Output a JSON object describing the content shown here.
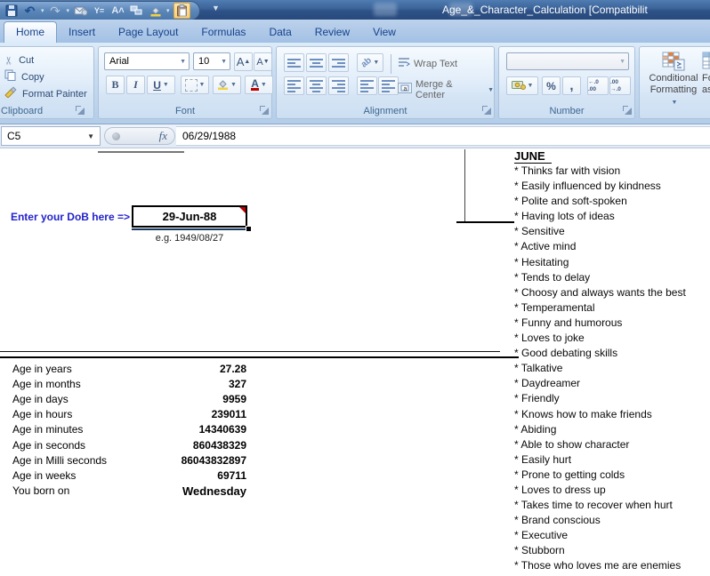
{
  "window": {
    "title": "Age_&_Character_Calculation  [Compatibilit"
  },
  "qat": {
    "icons": [
      "save-icon",
      "undo-icon",
      "redo-icon",
      "mail-attach-icon",
      "filter-icon",
      "font-size-icon",
      "shapes-icon",
      "fill-color-icon",
      "paste-icon",
      "customize-qat-icon"
    ]
  },
  "tabs": [
    {
      "label": "Home",
      "active": true
    },
    {
      "label": "Insert",
      "active": false
    },
    {
      "label": "Page Layout",
      "active": false
    },
    {
      "label": "Formulas",
      "active": false
    },
    {
      "label": "Data",
      "active": false
    },
    {
      "label": "Review",
      "active": false
    },
    {
      "label": "View",
      "active": false
    }
  ],
  "ribbon": {
    "clipboard": {
      "label": "Clipboard",
      "cut": "Cut",
      "copy": "Copy",
      "format_painter": "Format Painter"
    },
    "font": {
      "label": "Font",
      "family": "Arial",
      "size": "10",
      "bold": "B",
      "italic": "I",
      "underline": "U",
      "grow": "A",
      "shrink": "A",
      "color_letter": "A"
    },
    "alignment": {
      "label": "Alignment",
      "wrap_text": "Wrap Text",
      "merge_center": "Merge & Center",
      "orientation": "ab"
    },
    "number": {
      "label": "Number",
      "percent": "%",
      "comma": ",",
      "inc_decimal": "←.0 .00",
      "dec_decimal": ".00 →.0"
    },
    "styles": {
      "conditional_1": "Conditional",
      "conditional_2": "Formatting",
      "format_table_1": "For",
      "format_table_2": "as Ta"
    }
  },
  "formula_bar": {
    "name_box": "C5",
    "fx_label": "fx",
    "value": "06/29/1988"
  },
  "sheet": {
    "dob_label": "Enter your DoB here =>",
    "dob_value": "29-Jun-88",
    "dob_hint": "e.g. 1949/08/27",
    "month_header": "JUNE",
    "traits": [
      "* Thinks far with vision",
      "* Easily influenced by kindness",
      "* Polite and soft-spoken",
      "* Having lots of ideas",
      "* Sensitive",
      "* Active mind",
      "* Hesitating",
      "* Tends to delay",
      "* Choosy and always wants the best",
      "* Temperamental",
      "* Funny and humorous",
      "* Loves to joke",
      "* Good debating skills",
      "* Talkative",
      "* Daydreamer",
      "* Friendly",
      "* Knows how to make friends",
      "* Abiding",
      "* Able to show character",
      "* Easily hurt",
      "* Prone to getting colds",
      "* Loves to dress up",
      "* Takes time to recover when hurt",
      "* Brand conscious",
      "* Executive",
      "* Stubborn",
      "* Those who loves me are enemies"
    ],
    "age_rows": [
      {
        "label": "Age in years",
        "value": "27.28"
      },
      {
        "label": "Age in months",
        "value": "327"
      },
      {
        "label": "Age in days",
        "value": "9959"
      },
      {
        "label": "Age in hours",
        "value": "239011"
      },
      {
        "label": "Age in minutes",
        "value": "14340639"
      },
      {
        "label": "Age in seconds",
        "value": "860438329"
      },
      {
        "label": "Age in Milli seconds",
        "value": "86043832897"
      },
      {
        "label": "Age in weeks",
        "value": "69711"
      },
      {
        "label": "You born on",
        "value": "Wednesday"
      }
    ]
  },
  "colors": {
    "titlebar_blue": "#3b6398",
    "tab_text": "#15428b",
    "ribbon_bg": "#cadef2",
    "group_label": "#3e6792",
    "dob_label_blue": "#2222cc",
    "comment_red": "#c00000",
    "border_black": "#000000"
  }
}
